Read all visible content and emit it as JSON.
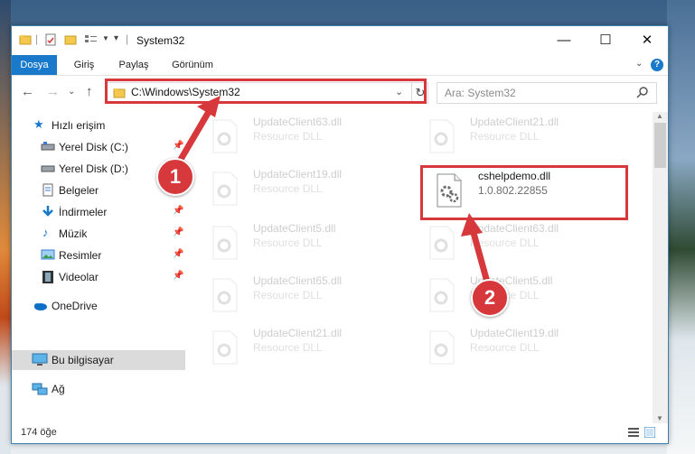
{
  "window": {
    "title": "System32",
    "controls": {
      "minimize": "—",
      "maximize": "☐",
      "close": "✕"
    }
  },
  "ribbon": {
    "tabs": [
      {
        "label": "Dosya",
        "active": true
      },
      {
        "label": "Giriş"
      },
      {
        "label": "Paylaş"
      },
      {
        "label": "Görünüm"
      }
    ],
    "help": "?",
    "collapse": "⌄"
  },
  "nav": {
    "back": "←",
    "forward": "→",
    "recent": "⌄",
    "up": "↑",
    "address": "C:\\Windows\\System32",
    "address_dropdown": "⌄",
    "refresh": "↻",
    "search_placeholder": "Ara: System32"
  },
  "sidebar": {
    "items": [
      {
        "label": "Hızlı erişim",
        "icon": "star-icon"
      },
      {
        "label": "Yerel Disk (C:)",
        "icon": "drive-icon",
        "pinned": true
      },
      {
        "label": "Yerel Disk (D:)",
        "icon": "drive-icon"
      },
      {
        "label": "Belgeler",
        "icon": "document-icon",
        "pinned": true
      },
      {
        "label": "İndirmeler",
        "icon": "download-icon",
        "pinned": true
      },
      {
        "label": "Müzik",
        "icon": "music-icon",
        "pinned": true
      },
      {
        "label": "Resimler",
        "icon": "picture-icon",
        "pinned": true
      },
      {
        "label": "Videolar",
        "icon": "video-icon",
        "pinned": true
      },
      {
        "label": "OneDrive",
        "icon": "cloud-icon"
      },
      {
        "label": "Bu bilgisayar",
        "icon": "computer-icon",
        "selected": true
      },
      {
        "label": "Ağ",
        "icon": "network-icon"
      }
    ],
    "pin_glyph": "📌"
  },
  "files": [
    {
      "name": "UpdateClient63.dll",
      "desc": "Resource DLL",
      "faded": true
    },
    {
      "name": "UpdateClient21.dll",
      "desc": "Resource DLL",
      "faded": true
    },
    {
      "name": "UpdateClient19.dll",
      "desc": "Resource DLL",
      "faded": true
    },
    {
      "name": "cshelpdemo.dll",
      "desc": "1.0.802.22855",
      "faded": false
    },
    {
      "name": "UpdateClient5.dll",
      "desc": "Resource DLL",
      "faded": true
    },
    {
      "name": "UpdateClient63.dll",
      "desc": "Resource DLL",
      "faded": true
    },
    {
      "name": "UpdateClient65.dll",
      "desc": "Resource DLL",
      "faded": true
    },
    {
      "name": "UpdateClient5.dll",
      "desc": "Resource DLL",
      "faded": true
    },
    {
      "name": "UpdateClient21.dll",
      "desc": "Resource DLL",
      "faded": true
    },
    {
      "name": "UpdateClient19.dll",
      "desc": "Resource DLL",
      "faded": true
    }
  ],
  "status": {
    "count": "174 öğe"
  },
  "annotations": {
    "badge1": "1",
    "badge2": "2",
    "color": "#d6383b"
  },
  "colors": {
    "accent": "#1979ca",
    "highlight": "#d6383b"
  }
}
